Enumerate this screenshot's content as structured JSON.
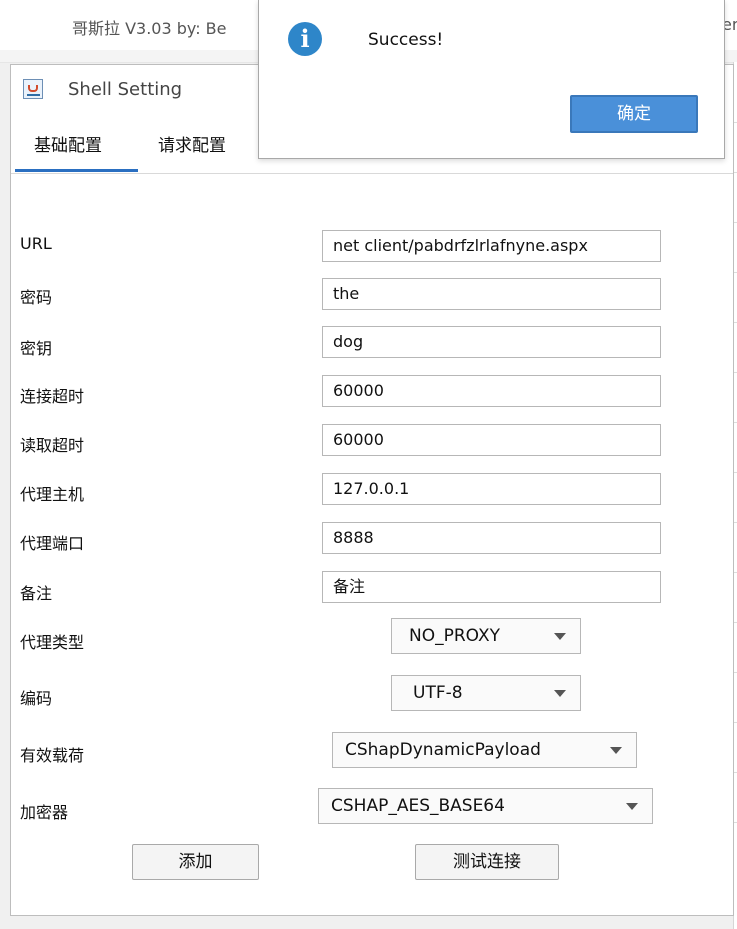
{
  "background_window": {
    "title": "哥斯拉 V3.03 by: Be",
    "title_right_fragment": "en"
  },
  "shell_setting": {
    "title": "Shell Setting",
    "tabs": [
      "基础配置",
      "请求配置"
    ],
    "fields": [
      {
        "label": "URL",
        "value": "net client/pabdrfzlrlafnyne.aspx"
      },
      {
        "label": "密码",
        "value": "the"
      },
      {
        "label": "密钥",
        "value": "dog"
      },
      {
        "label": "连接超时",
        "value": "60000"
      },
      {
        "label": "读取超时",
        "value": "60000"
      },
      {
        "label": "代理主机",
        "value": "127.0.0.1"
      },
      {
        "label": "代理端口",
        "value": "8888"
      },
      {
        "label": "备注",
        "value": "备注"
      }
    ],
    "selects": [
      {
        "label": "代理类型",
        "value": "NO_PROXY"
      },
      {
        "label": "编码",
        "value": "UTF-8"
      },
      {
        "label": "有效载荷",
        "value": "CShapDynamicPayload"
      },
      {
        "label": "加密器",
        "value": "CSHAP_AES_BASE64"
      }
    ],
    "buttons": {
      "add": "添加",
      "test": "测试连接"
    }
  },
  "message_dialog": {
    "icon": "info-icon",
    "text": "Success!",
    "ok_label": "确定",
    "accent": "#4a90d9"
  }
}
